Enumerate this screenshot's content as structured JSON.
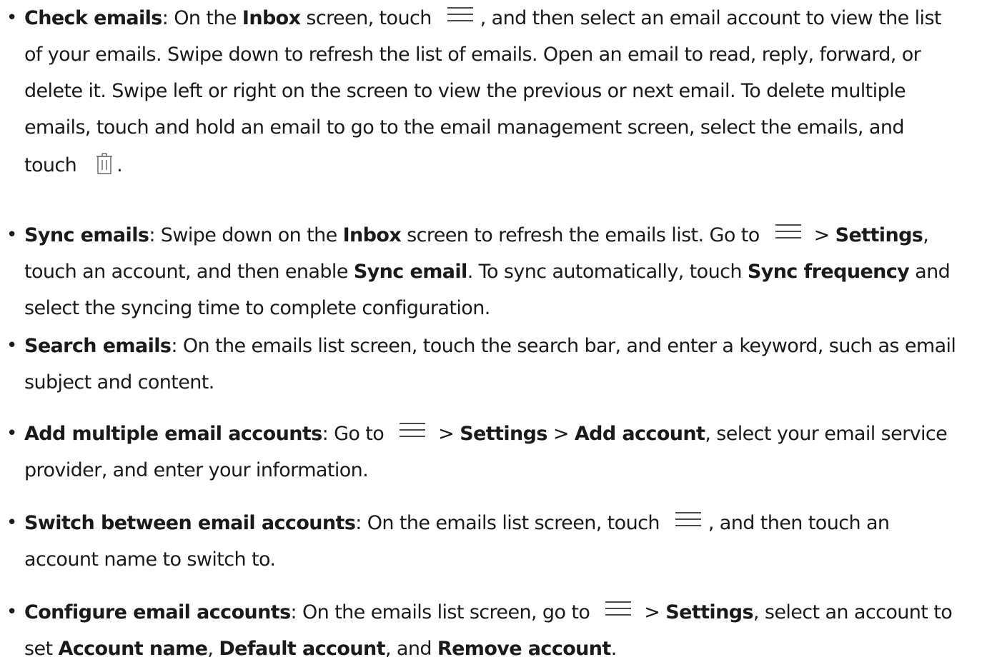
{
  "items": [
    {
      "lines": [
        [
          {
            "b": "Check emails"
          },
          {
            "t": ": On the "
          },
          {
            "b": "Inbox"
          },
          {
            "t": " screen, touch "
          },
          {
            "icon": "menu-icon"
          },
          {
            "t": ", and then select an email account to view the list"
          }
        ],
        [
          {
            "t": "of your emails. Swipe down to refresh the list of emails. Open an email to read, reply, forward, or"
          }
        ],
        [
          {
            "t": "delete it. Swipe left or right on the screen to view the previous or next email. To delete multiple"
          }
        ],
        [
          {
            "t": "emails, touch and hold an email to go to the email management screen, select the emails, and"
          }
        ],
        [
          {
            "t": "touch "
          },
          {
            "icon": "trash-icon"
          },
          {
            "t": "."
          }
        ]
      ]
    },
    {
      "lines": [
        [
          {
            "b": "Sync emails"
          },
          {
            "t": ": Swipe down on the "
          },
          {
            "b": "Inbox"
          },
          {
            "t": " screen to refresh the emails list. Go to "
          },
          {
            "icon": "menu-icon"
          },
          {
            "t": " > "
          },
          {
            "b": "Settings"
          },
          {
            "t": ","
          }
        ],
        [
          {
            "t": "touch an account, and then enable "
          },
          {
            "b": "Sync email"
          },
          {
            "t": ". To sync automatically, touch "
          },
          {
            "b": "Sync frequency"
          },
          {
            "t": " and"
          }
        ],
        [
          {
            "t": "select the syncing time to complete configuration."
          }
        ]
      ]
    },
    {
      "lines": [
        [
          {
            "b": "Search emails"
          },
          {
            "t": ": On the emails list screen, touch the search bar, and enter a keyword, such as email"
          }
        ],
        [
          {
            "t": "subject and content."
          }
        ]
      ]
    },
    {
      "lines": [
        [
          {
            "b": "Add multiple email accounts"
          },
          {
            "t": ": Go to "
          },
          {
            "icon": "menu-icon"
          },
          {
            "t": " > "
          },
          {
            "b": "Settings"
          },
          {
            "t": " > "
          },
          {
            "b": "Add account"
          },
          {
            "t": ", select your email service"
          }
        ],
        [
          {
            "t": "provider, and enter your information."
          }
        ]
      ]
    },
    {
      "lines": [
        [
          {
            "b": "Switch between email accounts"
          },
          {
            "t": ": On the emails list screen, touch "
          },
          {
            "icon": "menu-icon"
          },
          {
            "t": ", and then touch an"
          }
        ],
        [
          {
            "t": "account name to switch to."
          }
        ]
      ]
    },
    {
      "lines": [
        [
          {
            "b": "Configure email accounts"
          },
          {
            "t": ": On the emails list screen, go to "
          },
          {
            "icon": "menu-icon"
          },
          {
            "t": " > "
          },
          {
            "b": "Settings"
          },
          {
            "t": ", select an account to"
          }
        ],
        [
          {
            "t": "set "
          },
          {
            "b": "Account name"
          },
          {
            "t": ", "
          },
          {
            "b": "Default account"
          },
          {
            "t": ", and "
          },
          {
            "b": "Remove account"
          },
          {
            "t": "."
          }
        ]
      ]
    }
  ]
}
